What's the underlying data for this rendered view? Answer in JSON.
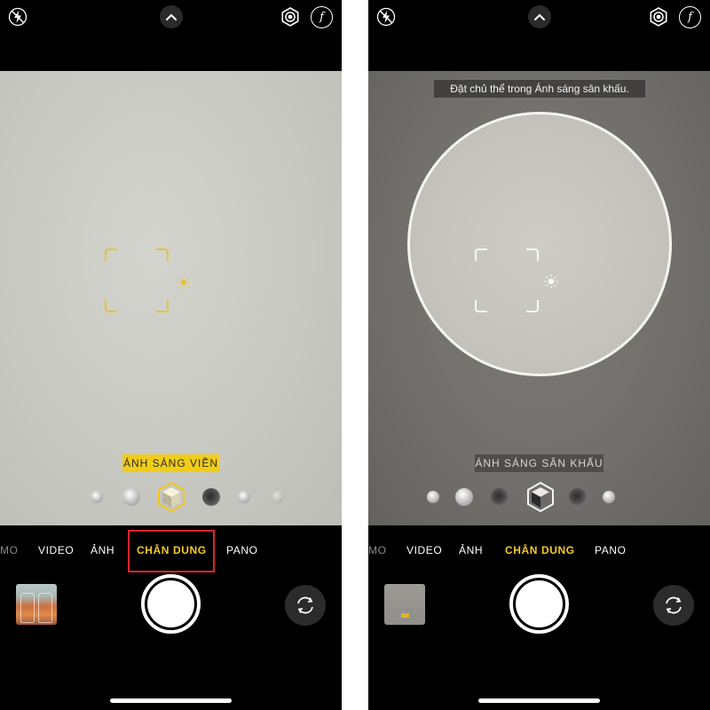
{
  "screens": [
    {
      "hint": "",
      "lighting_label": "ÁNH SÁNG VIỀN",
      "modes": [
        "MO",
        "VIDEO",
        "ẢNH",
        "CHÂN DUNG",
        "PANO"
      ],
      "active_mode": "CHÂN DUNG",
      "active_mode_highlighted": true,
      "thumbnail_icon": "drinks-photo-thumbnail",
      "accent_color": "#f1cd1a",
      "highlight_color": "#e0242b"
    },
    {
      "hint": "Đặt chủ thể trong Ánh sáng sân khấu.",
      "lighting_label": "ÁNH SÁNG SÂN KHẤU",
      "modes": [
        "MO",
        "VIDEO",
        "ẢNH",
        "CHÂN DUNG",
        "PANO"
      ],
      "active_mode": "CHÂN DUNG",
      "active_mode_highlighted": false,
      "thumbnail_icon": "gray-photo-thumbnail",
      "accent_color": "#f5c922"
    }
  ],
  "icons": {
    "flash": "flash-off-icon",
    "chevron": "chevron-up-icon",
    "live": "live-photo-icon",
    "fstop": "f-stop-icon",
    "flip": "camera-flip-icon"
  },
  "fstop_glyph": "f"
}
